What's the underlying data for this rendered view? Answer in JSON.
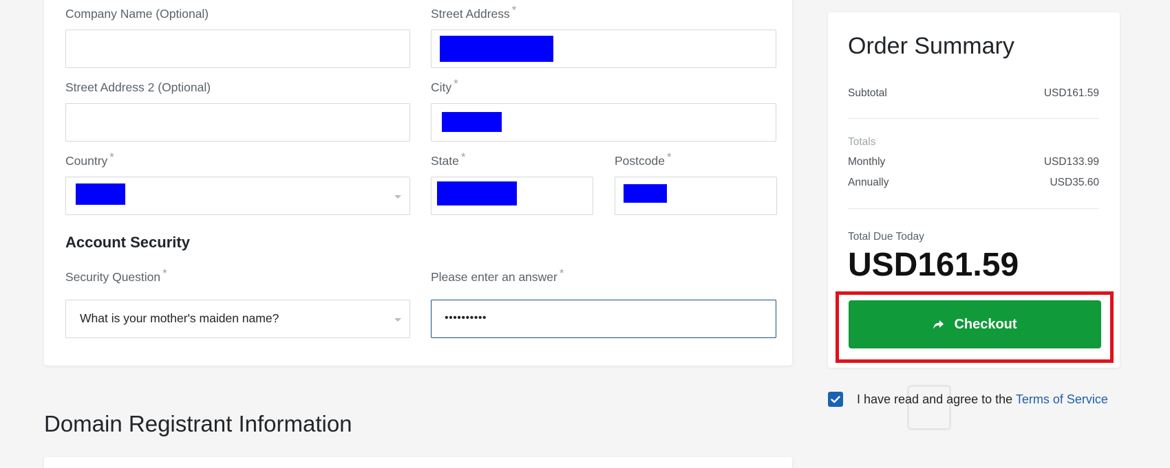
{
  "form": {
    "company_name": {
      "label": "Company Name (Optional)",
      "value": ""
    },
    "street_address": {
      "label": "Street Address",
      "required": "*"
    },
    "street_address2": {
      "label": "Street Address 2 (Optional)",
      "value": ""
    },
    "city": {
      "label": "City",
      "required": "*"
    },
    "country": {
      "label": "Country",
      "required": "*"
    },
    "state": {
      "label": "State",
      "required": "*"
    },
    "postcode": {
      "label": "Postcode",
      "required": "*"
    },
    "account_security_heading": "Account Security",
    "security_question": {
      "label": "Security Question",
      "required": "*",
      "value": "What is your mother's maiden name?"
    },
    "answer": {
      "label": "Please enter an answer",
      "required": "*",
      "value": "••••••••••"
    }
  },
  "domain_registrant_heading": "Domain Registrant Information",
  "summary": {
    "title": "Order Summary",
    "subtotal_label": "Subtotal",
    "subtotal_value": "USD161.59",
    "totals_label": "Totals",
    "monthly_label": "Monthly",
    "monthly_value": "USD133.99",
    "annually_label": "Annually",
    "annually_value": "USD35.60",
    "due_label": "Total Due Today",
    "due_amount": "USD161.59",
    "checkout_label": "Checkout"
  },
  "terms": {
    "text": "I have read and agree to the ",
    "link": "Terms of Service",
    "checked": true
  },
  "icons": {
    "checkout": "share-arrow-icon",
    "dropdown": "caret-down-icon",
    "checkbox": "check-icon"
  },
  "colors": {
    "checkout_button": "#109a39",
    "highlight": "#e0121b",
    "link": "#1f5fa8",
    "checkbox": "#1b63b1",
    "redaction": "#0000ff"
  }
}
